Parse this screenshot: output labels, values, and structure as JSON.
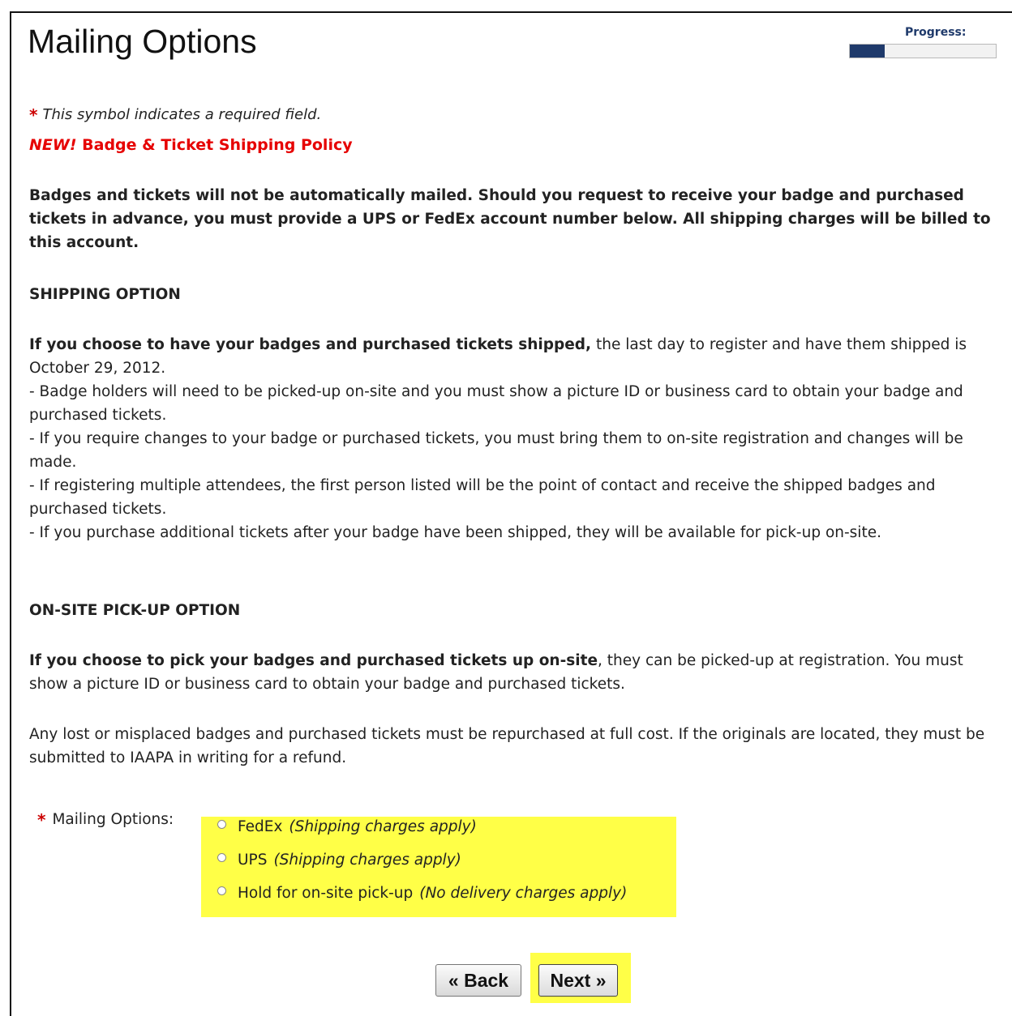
{
  "page": {
    "title": "Mailing Options",
    "progress_label": "Progress:",
    "progress_fraction": 0.24
  },
  "required_note": "This symbol indicates a required field.",
  "required_symbol": "*",
  "policy": {
    "new_label": "NEW!",
    "title": "Badge & Ticket Shipping Policy"
  },
  "intro": "Badges and tickets will not be automatically mailed. Should you request to receive your badge and purchased tickets in advance, you must provide a UPS or FedEx account number below. All shipping charges will be billed to this account.",
  "shipping": {
    "heading": "SHIPPING OPTION",
    "lead_bold": "If you choose to have your badges and purchased tickets shipped,",
    "lead_rest": " the last day to register and have them shipped is October 29, 2012.",
    "bullets": [
      "- Badge holders will need to be picked-up on-site and you must show a picture ID or business card to obtain your badge and purchased tickets.",
      "- If you require changes to your badge or purchased tickets, you must bring them to on-site registration and changes will be made.",
      "- If registering multiple attendees, the first person listed will be the point of contact and receive the shipped badges and purchased tickets.",
      "- If you purchase additional tickets after your badge have been shipped, they will be available for pick-up on-site."
    ]
  },
  "onsite": {
    "heading": "ON-SITE PICK-UP OPTION",
    "lead_bold": "If you choose to pick your badges and purchased tickets up on-site",
    "lead_rest": ", they can be picked-up at registration. You must show a picture ID or business card to obtain your badge and purchased tickets."
  },
  "lost_note": "Any lost or misplaced badges and purchased tickets must be repurchased at full cost. If the originals are located, they must be submitted to IAAPA in writing for a refund.",
  "mailing": {
    "label": "Mailing Options:",
    "options": [
      {
        "label": "FedEx",
        "note": "(Shipping charges apply)"
      },
      {
        "label": "UPS",
        "note": "(Shipping charges apply)"
      },
      {
        "label": "Hold for on-site pick-up",
        "note": "(No delivery charges apply)"
      }
    ]
  },
  "buttons": {
    "back": "« Back",
    "next": "Next »"
  },
  "colors": {
    "highlight": "#ffff47",
    "required": "#cc0000",
    "policy": "#e60000",
    "progress": "#1f3a6b"
  }
}
